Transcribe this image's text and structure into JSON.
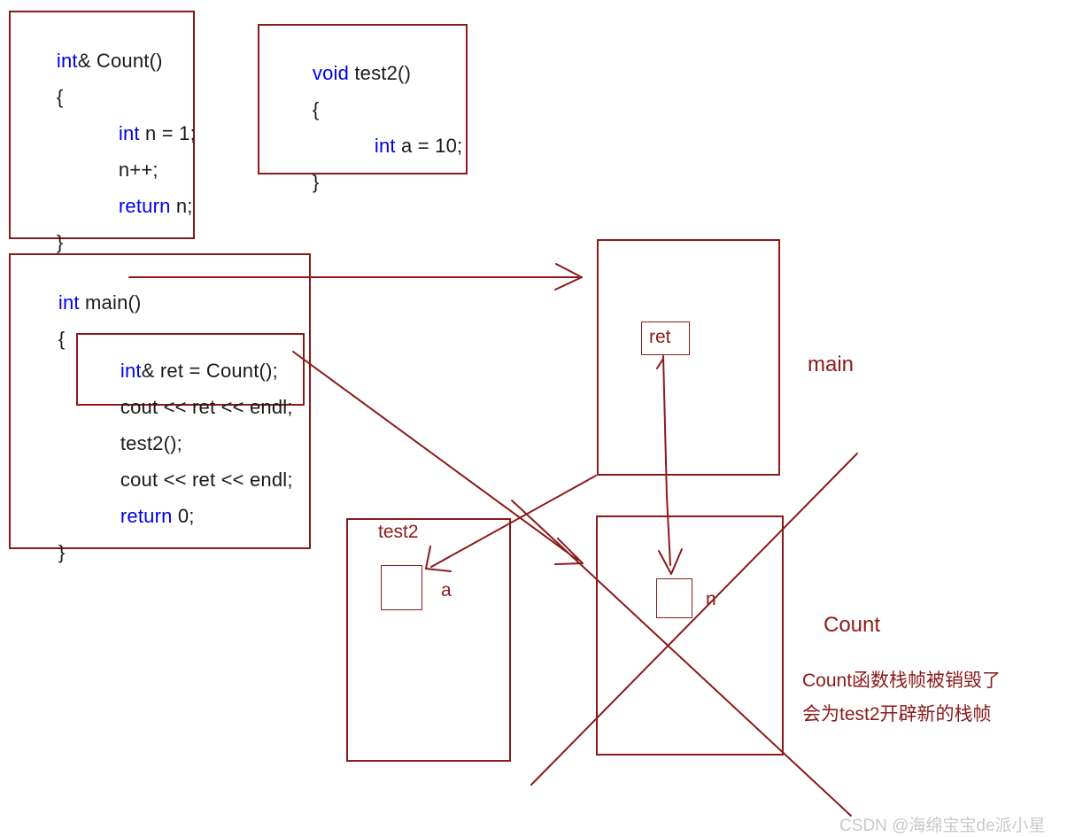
{
  "diagram": {
    "title_hidden": "C++ reference return value stack frame diagram",
    "accent_color": "#8b1a1a",
    "keyword_color": "#0000e6",
    "text_color": "#1a1a1a"
  },
  "code_blocks": {
    "count_fn": {
      "name": "Count",
      "lines": [
        {
          "kw": "int",
          "rest": "& Count()"
        },
        {
          "kw": "",
          "rest": "{"
        },
        {
          "kw": "int",
          "rest": " n = 1;"
        },
        {
          "kw": "",
          "rest": "n++;"
        },
        {
          "kw": "return",
          "rest": " n;"
        },
        {
          "kw": "",
          "rest": "}"
        }
      ]
    },
    "test2_fn": {
      "name": "test2",
      "lines": [
        {
          "kw": "void",
          "rest": " test2()"
        },
        {
          "kw": "",
          "rest": "{"
        },
        {
          "kw": "int",
          "rest": " a = 10;"
        },
        {
          "kw": "",
          "rest": "}"
        }
      ]
    },
    "main_fn": {
      "name": "main",
      "lines": [
        {
          "kw": "int",
          "rest": " main()"
        },
        {
          "kw": "",
          "rest": "{"
        },
        {
          "kw": "int",
          "rest": "& ret = Count();"
        },
        {
          "kw": "",
          "rest": "cout << ret << endl;"
        },
        {
          "kw": "",
          "rest": "test2();"
        },
        {
          "kw": "",
          "rest": "cout << ret << endl;"
        },
        {
          "kw": "return",
          "rest": " 0;"
        },
        {
          "kw": "",
          "rest": "}"
        }
      ]
    }
  },
  "stack_frames": {
    "main_frame": {
      "label": "main",
      "slot_label": "ret"
    },
    "test2_frame": {
      "label": "test2",
      "slot_label": "a"
    },
    "count_frame": {
      "label": "Count",
      "slot_label": "n",
      "crossed_out": true
    }
  },
  "annotations": {
    "note_line1": "Count函数栈帧被销毁了",
    "note_line2": "会为test2开辟新的栈帧"
  },
  "watermark": {
    "text": "CSDN @海绵宝宝de派小星"
  }
}
